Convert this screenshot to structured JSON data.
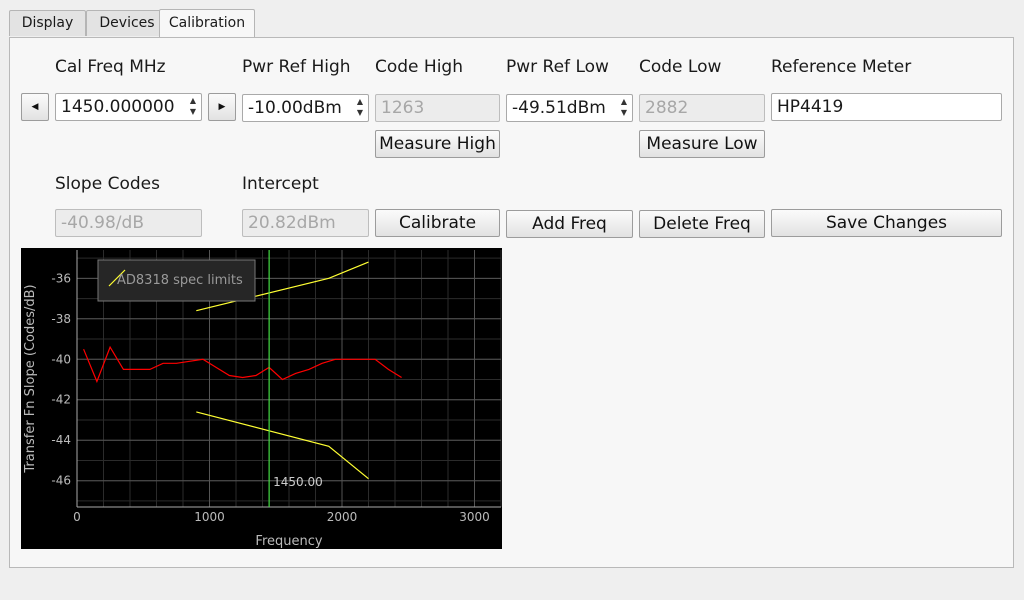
{
  "tabs": [
    "Display",
    "Devices",
    "Calibration"
  ],
  "active_tab": "Calibration",
  "cal": {
    "cal_freq_label": "Cal Freq MHz",
    "cal_freq_value": "1450.000000",
    "pwr_ref_high_label": "Pwr Ref High",
    "pwr_ref_high_value": "-10.00dBm",
    "code_high_label": "Code High",
    "code_high_value": "1263",
    "pwr_ref_low_label": "Pwr Ref Low",
    "pwr_ref_low_value": "-49.51dBm",
    "code_low_label": "Code Low",
    "code_low_value": "2882",
    "reference_meter_label": "Reference Meter",
    "reference_meter_value": "HP4419",
    "slope_label": "Slope Codes",
    "slope_value": "-40.98/dB",
    "intercept_label": "Intercept",
    "intercept_value": "20.82dBm"
  },
  "buttons": {
    "measure_high": "Measure High",
    "measure_low": "Measure Low",
    "calibrate": "Calibrate",
    "add_freq": "Add Freq",
    "delete_freq": "Delete Freq",
    "save_changes": "Save Changes"
  },
  "icons": {
    "prev": "left-arrow-icon",
    "next": "right-arrow-icon",
    "spin": "spin-arrows-icon"
  },
  "chart_data": {
    "type": "line",
    "xlabel": "Frequency",
    "ylabel": "Transfer Fn Slope (Codes/dB)",
    "xlim": [
      0,
      3200
    ],
    "ylim": [
      -47.3,
      -34.6
    ],
    "xticks": [
      0,
      1000,
      2000,
      3000
    ],
    "yticks": [
      -36,
      -38,
      -40,
      -42,
      -44,
      -46
    ],
    "grid": true,
    "legend": {
      "position": "top-left",
      "entries": [
        "AD8318 spec limits"
      ]
    },
    "cursor": {
      "x": 1450,
      "label": "1450.00"
    },
    "series": [
      {
        "name": "",
        "color": "#ff0000",
        "points": [
          [
            50,
            -39.5
          ],
          [
            150,
            -41.1
          ],
          [
            250,
            -39.4
          ],
          [
            350,
            -40.5
          ],
          [
            450,
            -40.5
          ],
          [
            550,
            -40.5
          ],
          [
            650,
            -40.2
          ],
          [
            750,
            -40.2
          ],
          [
            850,
            -40.1
          ],
          [
            950,
            -40.0
          ],
          [
            1050,
            -40.4
          ],
          [
            1150,
            -40.8
          ],
          [
            1250,
            -40.9
          ],
          [
            1350,
            -40.8
          ],
          [
            1450,
            -40.4
          ],
          [
            1550,
            -41.0
          ],
          [
            1650,
            -40.7
          ],
          [
            1750,
            -40.5
          ],
          [
            1850,
            -40.2
          ],
          [
            1950,
            -40.0
          ],
          [
            2050,
            -40.0
          ],
          [
            2150,
            -40.0
          ],
          [
            2250,
            -40.0
          ],
          [
            2350,
            -40.5
          ],
          [
            2450,
            -40.9
          ]
        ]
      },
      {
        "name": "AD8318 spec limits",
        "color": "#ffff33",
        "points": [
          [
            900,
            -37.6
          ],
          [
            1900,
            -36.0
          ],
          [
            2200,
            -35.2
          ]
        ]
      },
      {
        "name": "",
        "color": "#ffff33",
        "points": [
          [
            900,
            -42.6
          ],
          [
            1900,
            -44.3
          ],
          [
            2200,
            -45.9
          ]
        ]
      }
    ]
  }
}
